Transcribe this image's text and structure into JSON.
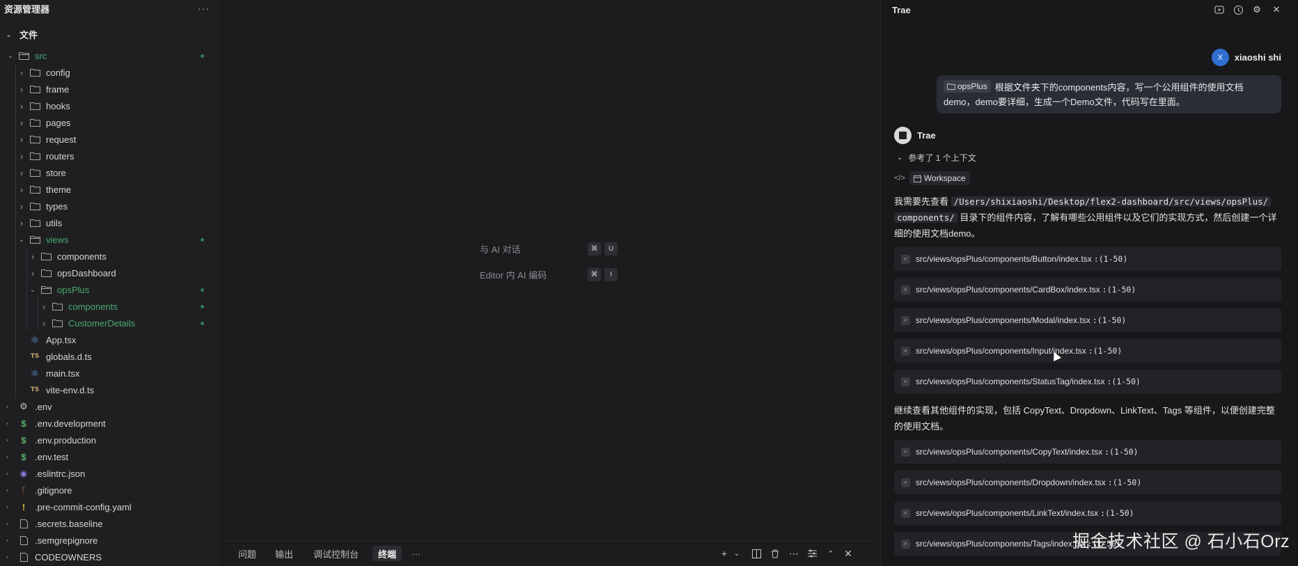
{
  "explorer": {
    "title": "资源管理器",
    "more": "···",
    "section": "文件",
    "items": [
      {
        "label": "src",
        "type": "folder",
        "depth": 0,
        "open": true,
        "git": true
      },
      {
        "label": "config",
        "type": "folder",
        "depth": 1
      },
      {
        "label": "frame",
        "type": "folder",
        "depth": 1
      },
      {
        "label": "hooks",
        "type": "folder",
        "depth": 1
      },
      {
        "label": "pages",
        "type": "folder",
        "depth": 1
      },
      {
        "label": "request",
        "type": "folder",
        "depth": 1
      },
      {
        "label": "routers",
        "type": "folder",
        "depth": 1
      },
      {
        "label": "store",
        "type": "folder",
        "depth": 1
      },
      {
        "label": "theme",
        "type": "folder",
        "depth": 1
      },
      {
        "label": "types",
        "type": "folder",
        "depth": 1
      },
      {
        "label": "utils",
        "type": "folder",
        "depth": 1
      },
      {
        "label": "views",
        "type": "folder",
        "depth": 1,
        "open": true,
        "git": true
      },
      {
        "label": "components",
        "type": "folder",
        "depth": 2
      },
      {
        "label": "opsDashboard",
        "type": "folder",
        "depth": 2
      },
      {
        "label": "opsPlus",
        "type": "folder",
        "depth": 2,
        "open": true,
        "git": true
      },
      {
        "label": "components",
        "type": "folder",
        "depth": 3,
        "git": true
      },
      {
        "label": "CustomerDetails",
        "type": "folder",
        "depth": 3,
        "git": true
      },
      {
        "label": "App.tsx",
        "type": "react",
        "depth": 1
      },
      {
        "label": "globals.d.ts",
        "type": "ts",
        "depth": 1
      },
      {
        "label": "main.tsx",
        "type": "react",
        "depth": 1
      },
      {
        "label": "vite-env.d.ts",
        "type": "ts",
        "depth": 1
      },
      {
        "label": ".env",
        "type": "gear",
        "depth": 0
      },
      {
        "label": ".env.development",
        "type": "dollar",
        "depth": 0
      },
      {
        "label": ".env.production",
        "type": "dollar",
        "depth": 0
      },
      {
        "label": ".env.test",
        "type": "dollar",
        "depth": 0
      },
      {
        "label": ".eslintrc.json",
        "type": "eslint",
        "depth": 0
      },
      {
        "label": ".gitignore",
        "type": "git",
        "depth": 0
      },
      {
        "label": ".pre-commit-config.yaml",
        "type": "bang",
        "depth": 0
      },
      {
        "label": ".secrets.baseline",
        "type": "file",
        "depth": 0
      },
      {
        "label": ".semgrepignore",
        "type": "file",
        "depth": 0
      },
      {
        "label": "CODEOWNERS",
        "type": "file",
        "depth": 0
      }
    ]
  },
  "editor": {
    "hints": [
      {
        "text": "与 AI 对话",
        "keys": [
          "⌘",
          "U"
        ]
      },
      {
        "text": "Editor 内 AI 编码",
        "keys": [
          "⌘",
          "I"
        ]
      }
    ]
  },
  "panel": {
    "tabs": [
      "问题",
      "输出",
      "调试控制台",
      "终端"
    ],
    "active": "终端",
    "more": "···"
  },
  "chat": {
    "title": "Trae",
    "user": {
      "initial": "X",
      "name": "xiaoshi shi"
    },
    "message": {
      "chip": "opsPlus",
      "line1": "根据文件夹下的components内容，写一个公用组件的使用文档",
      "line2": "demo，demo要详细，生成一个Demo文件，代码写在里面。"
    },
    "assistant_name": "Trae",
    "reference": "参考了 1 个上下文",
    "workspace": "Workspace",
    "para1_pre": "我需要先查看 ",
    "para1_code1": "/Users/shixiaoshi/Desktop/flex2-dashboard/src/views/opsPlus/",
    "para1_code2": "components/",
    "para1_post": " 目录下的组件内容，了解有哪些公用组件以及它们的实现方式，然后创建一个详",
    "para1_post2": "细的使用文档demo。",
    "reads1": [
      {
        "path": "src/views/opsPlus/components/Button/index.tsx",
        "range": ":(1-50)"
      },
      {
        "path": "src/views/opsPlus/components/CardBox/index.tsx",
        "range": ":(1-50)"
      },
      {
        "path": "src/views/opsPlus/components/Modal/index.tsx",
        "range": ":(1-50)"
      },
      {
        "path": "src/views/opsPlus/components/Input/index.tsx",
        "range": ":(1-50)"
      },
      {
        "path": "src/views/opsPlus/components/StatusTag/index.tsx",
        "range": ":(1-50)"
      }
    ],
    "para2_line1": "继续查看其他组件的实现，包括 CopyText、Dropdown、LinkText、Tags 等组件，以便创建完整",
    "para2_line2": "的使用文档。",
    "reads2": [
      {
        "path": "src/views/opsPlus/components/CopyText/index.tsx",
        "range": ":(1-50)"
      },
      {
        "path": "src/views/opsPlus/components/Dropdown/index.tsx",
        "range": ":(1-50)"
      },
      {
        "path": "src/views/opsPlus/components/LinkText/index.tsx",
        "range": ":(1-50)"
      },
      {
        "path": "src/views/opsPlus/components/Tags/index.tsx",
        "range": ":(1-50)"
      }
    ]
  },
  "watermark": "掘金技术社区 @ 石小石Orz"
}
